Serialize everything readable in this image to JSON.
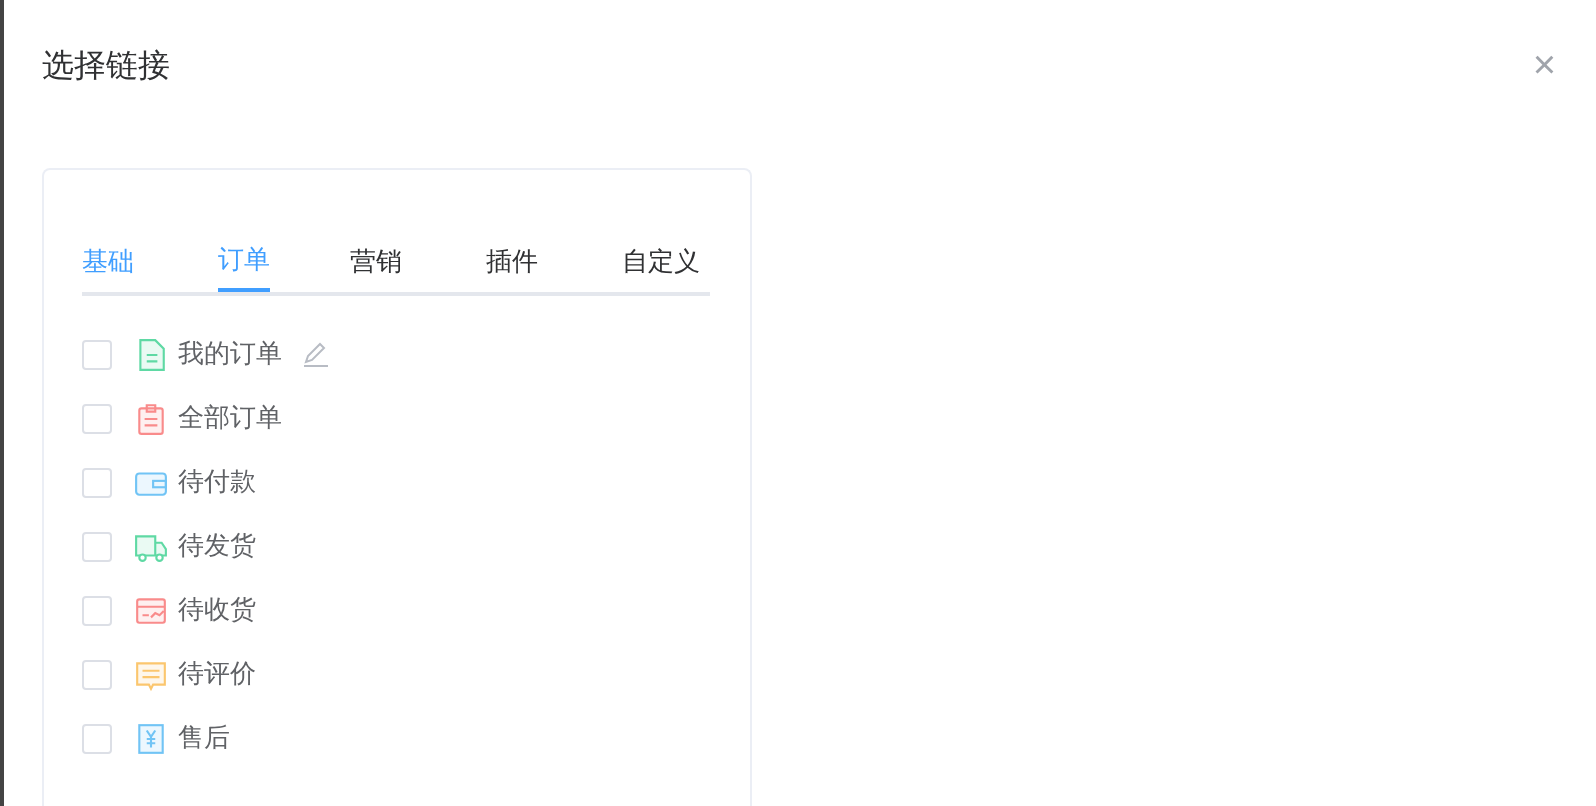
{
  "dialog": {
    "title": "选择链接",
    "close": "×"
  },
  "tabs": [
    {
      "label": "基础",
      "selected": false,
      "hovered": true
    },
    {
      "label": "订单",
      "selected": true,
      "hovered": false
    },
    {
      "label": "营销",
      "selected": false,
      "hovered": false
    },
    {
      "label": "插件",
      "selected": false,
      "hovered": false
    },
    {
      "label": "自定义",
      "selected": false,
      "hovered": false
    }
  ],
  "items": [
    {
      "label": "我的订单",
      "kind": "document",
      "color": "#5fd9a4",
      "checked": false,
      "editable": true
    },
    {
      "label": "全部订单",
      "kind": "clipboard",
      "color": "#f98b8b",
      "checked": false,
      "editable": false
    },
    {
      "label": "待付款",
      "kind": "wallet",
      "color": "#71c4f5",
      "checked": false,
      "editable": false
    },
    {
      "label": "待发货",
      "kind": "truck",
      "color": "#5fd9a4",
      "checked": false,
      "editable": false
    },
    {
      "label": "待收货",
      "kind": "inbox",
      "color": "#f98b8b",
      "checked": false,
      "editable": false
    },
    {
      "label": "待评价",
      "kind": "message",
      "color": "#fbc66e",
      "checked": false,
      "editable": false
    },
    {
      "label": "售后",
      "kind": "yuan",
      "color": "#71c4f5",
      "checked": false,
      "editable": false
    }
  ]
}
